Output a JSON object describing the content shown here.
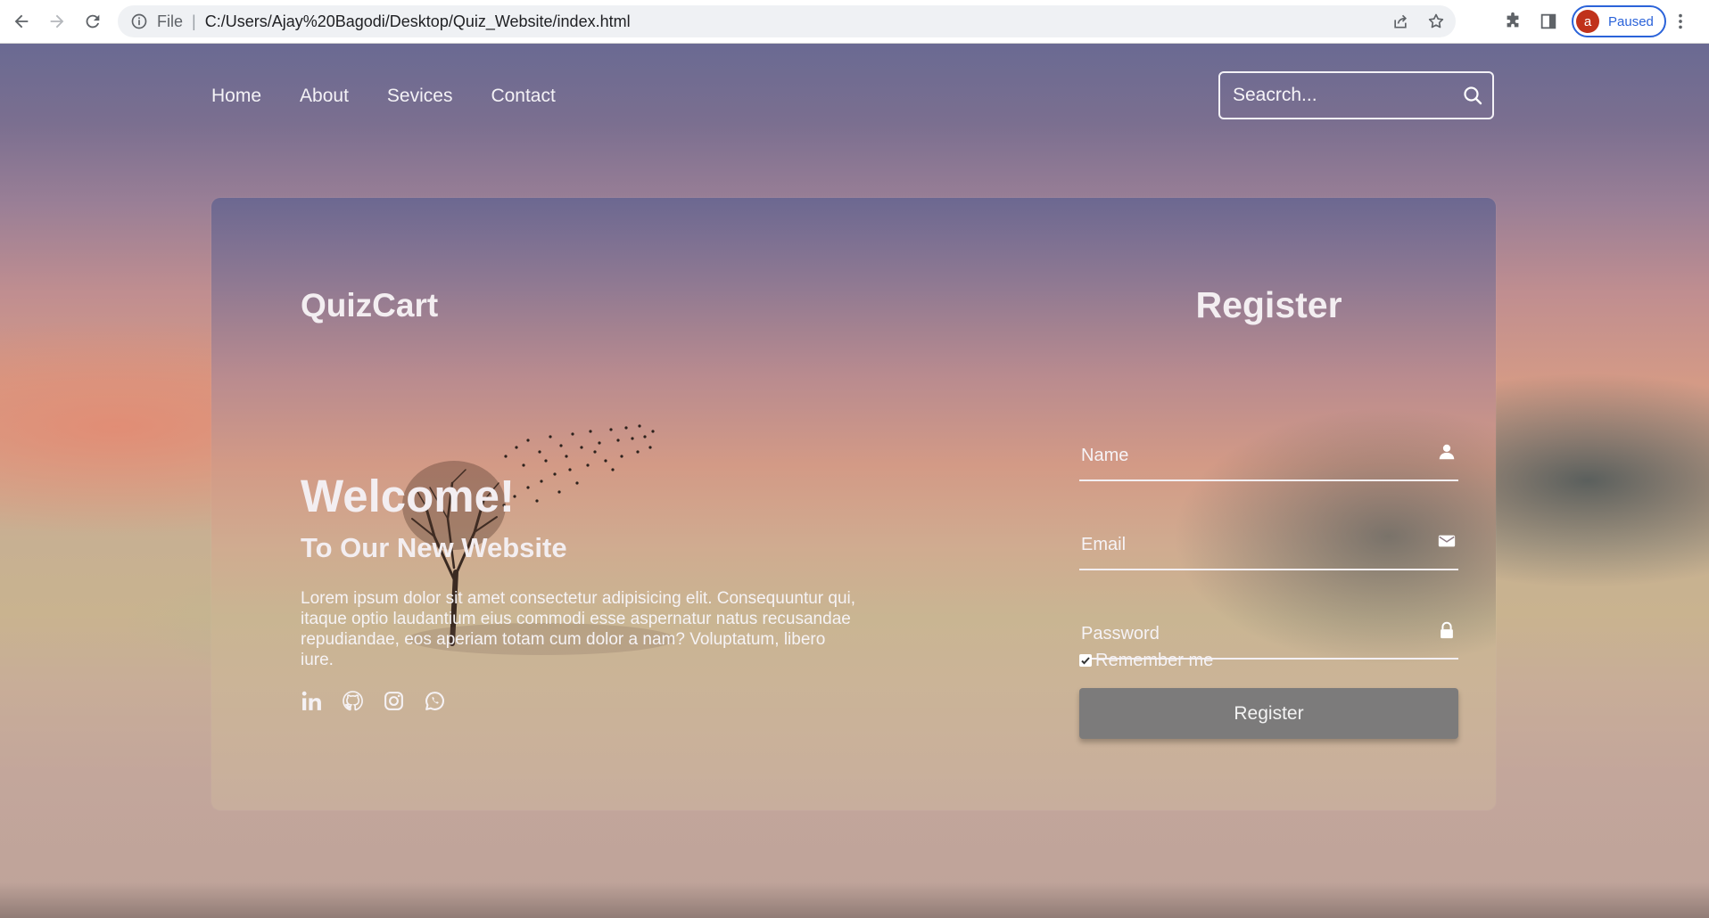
{
  "browser": {
    "file_label": "File",
    "url": "C:/Users/Ajay%20Bagodi/Desktop/Quiz_Website/index.html",
    "profile_initial": "a",
    "profile_status": "Paused"
  },
  "nav": {
    "items": [
      "Home",
      "About",
      "Sevices",
      "Contact"
    ],
    "search_placeholder": "Seacrch..."
  },
  "brand": "QuizCart",
  "hero": {
    "title": "Welcome!",
    "subtitle": "To Our New Website",
    "text": "Lorem ipsum dolor sit amet consectetur adipisicing elit. Consequuntur qui, itaque optio laudantium eius commodi esse aspernatur natus recusandae repudiandae, eos aperiam totam cum dolor a nam? Voluptatum, libero iure."
  },
  "social": [
    "linkedin-icon",
    "github-icon",
    "instagram-icon",
    "whatsapp-icon"
  ],
  "register": {
    "title": "Register",
    "name_placeholder": "Name",
    "email_placeholder": "Email",
    "password_placeholder": "Password",
    "remember_label": "Remember me",
    "remember_checked": true,
    "button_label": "Register"
  }
}
